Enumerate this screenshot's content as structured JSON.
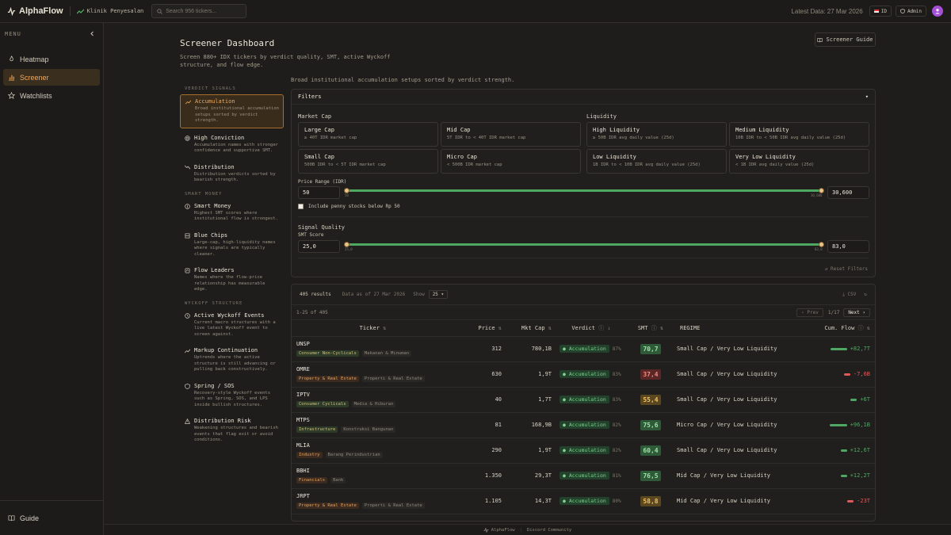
{
  "app": {
    "name": "AlphaFlow",
    "clinic": "Klinik Penyesalan",
    "search_placeholder": "Search 956 tickers...",
    "latest": "Latest Data: 27 Mar 2026",
    "lang": "ID",
    "admin": "Admin"
  },
  "sidebar": {
    "menu": "MENU",
    "items": [
      {
        "label": "Heatmap"
      },
      {
        "label": "Screener"
      },
      {
        "label": "Watchlists"
      }
    ],
    "guide": "Guide"
  },
  "page": {
    "title": "Screener Dashboard",
    "subtitle": "Screen 880+ IDX tickers by verdict quality, SMT, active Wyckoff structure, and flow edge.",
    "guide_button": "Screener Guide",
    "intro": "Broad institutional accumulation setups sorted by verdict strength."
  },
  "signals": {
    "verdict_label": "VERDICT SIGNALS",
    "verdict": [
      {
        "title": "Accumulation",
        "desc": "Broad institutional accumulation setups sorted by verdict strength."
      },
      {
        "title": "High Conviction",
        "desc": "Accumulation names with stronger confidence and supportive SMT."
      },
      {
        "title": "Distribution",
        "desc": "Distribution verdicts sorted by bearish strength."
      }
    ],
    "smart_label": "SMART MONEY",
    "smart": [
      {
        "title": "Smart Money",
        "desc": "Highest SMT scores where institutional flow is strongest."
      },
      {
        "title": "Blue Chips",
        "desc": "Large-cap, high-liquidity names where signals are typically cleaner."
      },
      {
        "title": "Flow Leaders",
        "desc": "Names where the flow-price relationship has measurable edge."
      }
    ],
    "wyckoff_label": "WYCKOFF STRUCTURE",
    "wyckoff": [
      {
        "title": "Active Wyckoff Events",
        "desc": "Current macro structures with a live latest Wyckoff event to screen against."
      },
      {
        "title": "Markup Continuation",
        "desc": "Uptrends where the active structure is still advancing or pulling back constructively."
      },
      {
        "title": "Spring / SOS",
        "desc": "Recovery-style Wyckoff events such as Spring, SOS, and LPS inside bullish structures."
      },
      {
        "title": "Distribution Risk",
        "desc": "Weakening structures and bearish events that flag exit or avoid conditions."
      }
    ]
  },
  "filters": {
    "title": "Filters",
    "market_cap_label": "Market Cap",
    "market_cap": [
      {
        "title": "Large Cap",
        "desc": "≥ 40T IDR market cap"
      },
      {
        "title": "Mid Cap",
        "desc": "5T IDR to < 40T IDR market cap"
      },
      {
        "title": "Small Cap",
        "desc": "500B IDR to < 5T IDR market cap"
      },
      {
        "title": "Micro Cap",
        "desc": "< 500B IDR market cap"
      }
    ],
    "liquidity_label": "Liquidity",
    "liquidity": [
      {
        "title": "High Liquidity",
        "desc": "≥ 50B IDR avg daily value (25d)"
      },
      {
        "title": "Medium Liquidity",
        "desc": "10B IDR to < 50B IDR avg daily value (25d)"
      },
      {
        "title": "Low Liquidity",
        "desc": "1B IDR to < 10B IDR avg daily value (25d)"
      },
      {
        "title": "Very Low Liquidity",
        "desc": "< 1B IDR avg daily value (25d)"
      }
    ],
    "price_label": "Price Range (IDR)",
    "price_min": "50",
    "price_max": "30,600",
    "price_tick_min": "50",
    "price_tick_max": "30,600",
    "penny": "Include penny stocks below Rp 50",
    "signal_label": "Signal Quality",
    "smt_label": "SMT Score",
    "smt_min": "25,0",
    "smt_max": "83,0",
    "smt_tick_min": "25,0",
    "smt_tick_max": "83,0",
    "reset": "Reset Filters"
  },
  "results": {
    "count": "405 results",
    "asof": "Data as of 27 Mar 2026",
    "show": "Show",
    "per_page": "25",
    "csv": "CSV",
    "range": "1-25 of 405",
    "prev": "Prev",
    "page": "1/17",
    "next": "Next"
  },
  "table": {
    "headers": {
      "ticker": "Ticker",
      "price": "Price",
      "mcap": "Mkt Cap",
      "verdict": "Verdict",
      "smt": "SMT",
      "regime": "REGIME",
      "flow": "Cum. Flow"
    },
    "rows": [
      {
        "code": "UNSP",
        "sector": "Consumer Non-Cyclicals",
        "sub": "Makanan & Minuman",
        "price": "312",
        "mcap": "780,1B",
        "verdict": "Accumulation",
        "pct": "87%",
        "smt": "70,7",
        "regime": "Small Cap / Very Low Liquidity",
        "flow": "+82,7T"
      },
      {
        "code": "OMRE",
        "sector": "Property & Real Estate",
        "sub": "Properti & Real Estate",
        "price": "630",
        "mcap": "1,9T",
        "verdict": "Accumulation",
        "pct": "83%",
        "smt": "37,4",
        "regime": "Small Cap / Very Low Liquidity",
        "flow": "-7,6B"
      },
      {
        "code": "IPTV",
        "sector": "Consumer Cyclicals",
        "sub": "Media & Hiburan",
        "price": "40",
        "mcap": "1,7T",
        "verdict": "Accumulation",
        "pct": "83%",
        "smt": "55,4",
        "regime": "Small Cap / Very Low Liquidity",
        "flow": "+6T"
      },
      {
        "code": "MTPS",
        "sector": "Infrastructure",
        "sub": "Konstruksi Bangunan",
        "price": "81",
        "mcap": "168,9B",
        "verdict": "Accumulation",
        "pct": "82%",
        "smt": "75,6",
        "regime": "Micro Cap / Very Low Liquidity",
        "flow": "+96,1B"
      },
      {
        "code": "MLIA",
        "sector": "Industry",
        "sub": "Barang Perindustrian",
        "price": "290",
        "mcap": "1,9T",
        "verdict": "Accumulation",
        "pct": "82%",
        "smt": "60,4",
        "regime": "Small Cap / Very Low Liquidity",
        "flow": "+12,6T"
      },
      {
        "code": "BBHI",
        "sector": "Financials",
        "sub": "Bank",
        "price": "1.350",
        "mcap": "29,3T",
        "verdict": "Accumulation",
        "pct": "81%",
        "smt": "76,5",
        "regime": "Mid Cap / Very Low Liquidity",
        "flow": "+12,2T"
      },
      {
        "code": "JRPT",
        "sector": "Property & Real Estate",
        "sub": "Properti & Real Estate",
        "price": "1.105",
        "mcap": "14,3T",
        "verdict": "Accumulation",
        "pct": "80%",
        "smt": "58,8",
        "regime": "Mid Cap / Very Low Liquidity",
        "flow": "-23T"
      }
    ]
  },
  "footer": {
    "brand": "AlphaFlow",
    "community": "Discord Community"
  }
}
